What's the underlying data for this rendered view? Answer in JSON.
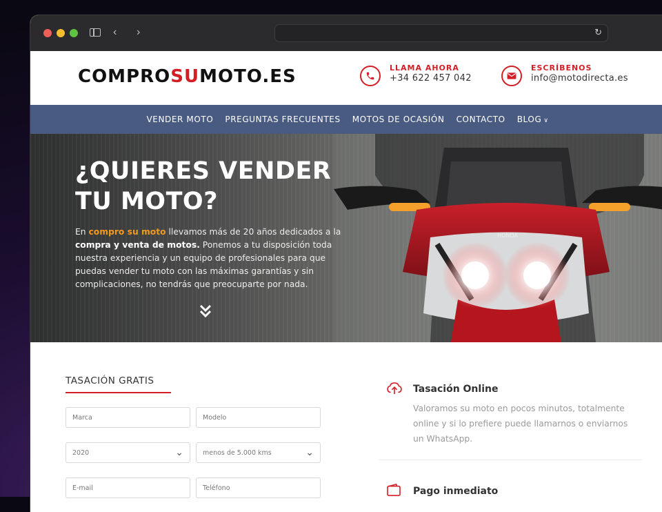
{
  "browser": {
    "url": ""
  },
  "header": {
    "logo": {
      "part1": "COMPRO",
      "part2": "SU",
      "part3": "MOTO.ES"
    },
    "phone": {
      "label": "LLAMA AHORA",
      "value": "+34 622 457 042"
    },
    "email": {
      "label": "ESCRÍBENOS",
      "value": "info@motodirecta.es"
    }
  },
  "nav": {
    "items": [
      {
        "label": "VENDER MOTO"
      },
      {
        "label": "PREGUNTAS FRECUENTES"
      },
      {
        "label": "MOTOS DE OCASIÓN"
      },
      {
        "label": "CONTACTO"
      },
      {
        "label": "BLOG"
      }
    ]
  },
  "hero": {
    "title_line1": "¿QUIERES VENDER",
    "title_line2": "TU MOTO?",
    "text_prefix": "En ",
    "text_highlight": "compro su moto",
    "text_mid": " llevamos más de 20 años dedicados a la ",
    "text_bold": "compra y venta de motos.",
    "text_rest": " Ponemos a tu disposición toda nuestra experiencia y un equipo de profesionales para que puedas vender tu moto con las máximas garantías y sin complicaciones, no tendrás que preocuparte por nada.",
    "bike_brand": "HONDA"
  },
  "form": {
    "title": "TASACIÓN GRATIS",
    "marca_placeholder": "Marca",
    "modelo_placeholder": "Modelo",
    "year_value": "2020",
    "km_value": "menos de 5.000 kms",
    "email_placeholder": "E-mail",
    "telefono_placeholder": "Teléfono"
  },
  "features": [
    {
      "title": "Tasación Online",
      "icon": "cloud-upload-icon",
      "text": "Valoramos su moto en pocos minutos, totalmente online y si lo prefiere puede llamarnos o enviarnos un WhatsApp."
    },
    {
      "title": "Pago inmediato",
      "icon": "wallet-icon"
    }
  ],
  "colors": {
    "accent": "#d21f26",
    "nav_bg": "#4a5b82",
    "highlight": "#f39a1e"
  }
}
